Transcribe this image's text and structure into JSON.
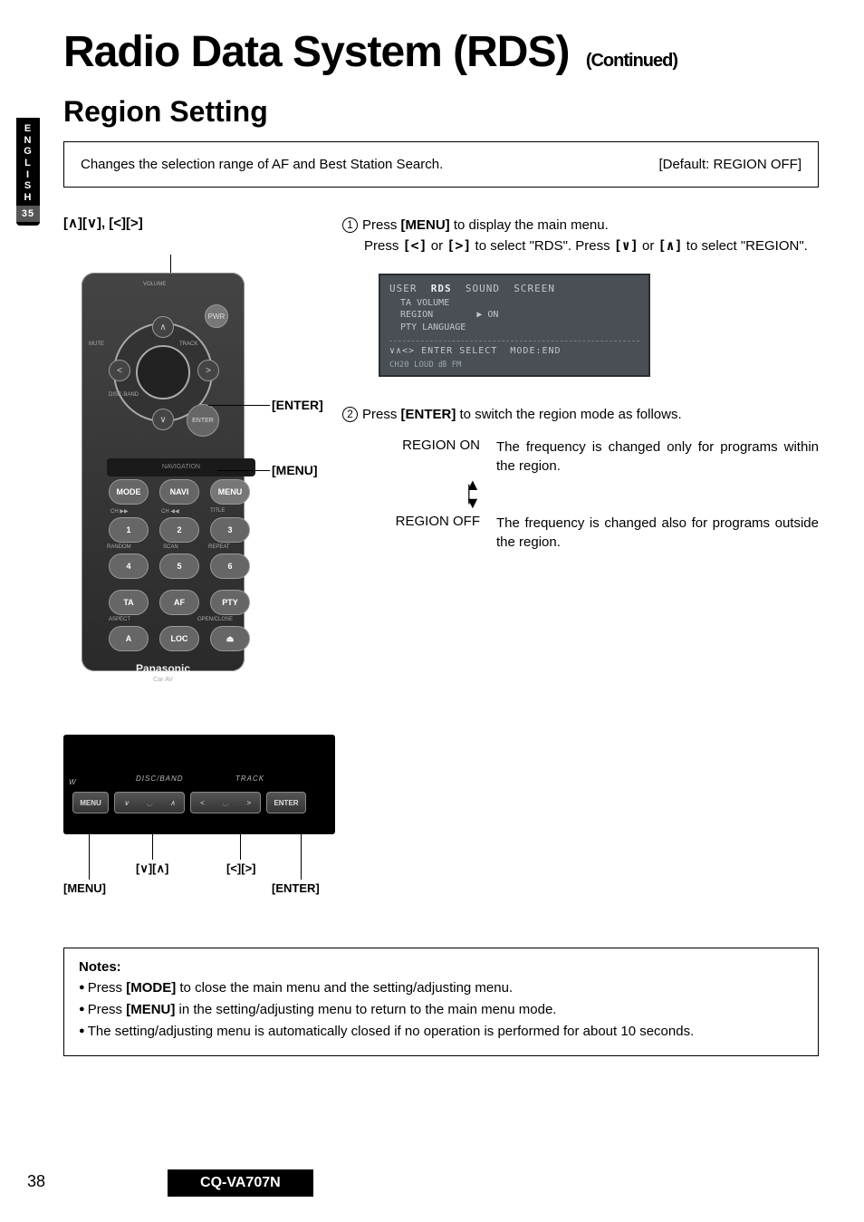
{
  "side_tab": {
    "lang": "E\nN\nG\nL\nI\nS\nH",
    "page_ref": "35"
  },
  "title": {
    "main": "Radio Data System (RDS)",
    "cont": "(Continued)"
  },
  "section_heading": "Region Setting",
  "intro": {
    "desc": "Changes the selection range of AF and Best Station Search.",
    "default": "[Default: REGION OFF]"
  },
  "remote": {
    "keys_label": "[∧][∨], [<][>]",
    "enter_callout": "[ENTER]",
    "menu_callout": "[MENU]",
    "buttons": {
      "pwr": "PWR",
      "enter": "ENTER",
      "mode": "MODE",
      "navi": "NAVI",
      "menu": "MENU",
      "ta": "TA",
      "af": "AF",
      "pty": "PTY",
      "a": "A",
      "loc": "LOC",
      "mute": "MUTE",
      "track": "TRACK",
      "disc_band": "DISC·BAND",
      "volume": "VOLUME",
      "nav_strip": "NAVIGATION",
      "nums": [
        "1",
        "2",
        "3",
        "4",
        "5",
        "6"
      ],
      "row1_sub": [
        "CH ▶▶",
        "CH ◀◀",
        "TITLE"
      ],
      "row2_sub": [
        "RANDOM",
        "SCAN",
        "REPEAT"
      ],
      "row4_sub": [
        "ASPECT",
        "",
        "OPEN/CLOSE"
      ],
      "eject": "⏏"
    },
    "brand": "Panasonic",
    "brand_sub": "Car AV"
  },
  "steps": {
    "s1a": "Press ",
    "s1a_key": "[MENU]",
    "s1a_tail": " to display the main menu.",
    "s1b_1": "Press ",
    "s1b_k1": "[<]",
    "s1b_2": " or ",
    "s1b_k2": "[>]",
    "s1b_3": " to select \"RDS\". Press ",
    "s1b_k3": "[∨]",
    "s1b_4": " or ",
    "s1b_k4": "[∧]",
    "s1b_5": " to select \"REGION\".",
    "s2a": "Press ",
    "s2a_key": "[ENTER]",
    "s2a_tail": " to switch the region mode as follows."
  },
  "lcd": {
    "tabs": "USER  RDS  SOUND  SCREEN",
    "rows": "  TA VOLUME\n  REGION        ▶ ON\n  PTY LANGUAGE",
    "help": "∨∧<> ENTER SELECT  MODE:END",
    "status": "CH20 LOUD ㏈ FM"
  },
  "modes": {
    "on_label": "REGION ON",
    "on_desc": "The frequency is changed only for programs within the region.",
    "off_label": "REGION OFF",
    "off_desc": "The frequency is changed also for programs outside the region."
  },
  "panel": {
    "group1": "DISC/BAND",
    "group2": "TRACK",
    "w": "W",
    "menu": "MENU",
    "enter": "ENTER",
    "down": "∨",
    "up": "∧",
    "left": "<",
    "right": ">",
    "call_va": "[∨][∧]",
    "call_lr": "[<][>]",
    "call_menu": "[MENU]",
    "call_enter": "[ENTER]"
  },
  "notes": {
    "heading": "Notes:",
    "items": [
      {
        "pre": "Press ",
        "key": "[MODE]",
        "post": " to close the main menu and the setting/adjusting menu."
      },
      {
        "pre": "Press ",
        "key": "[MENU]",
        "post": " in the setting/adjusting menu to return to the main menu mode."
      },
      {
        "pre": "",
        "key": "",
        "post": "The setting/adjusting menu is automatically closed if no operation is performed for about 10 seconds."
      }
    ]
  },
  "footer": {
    "page": "38",
    "model": "CQ-VA707N"
  }
}
